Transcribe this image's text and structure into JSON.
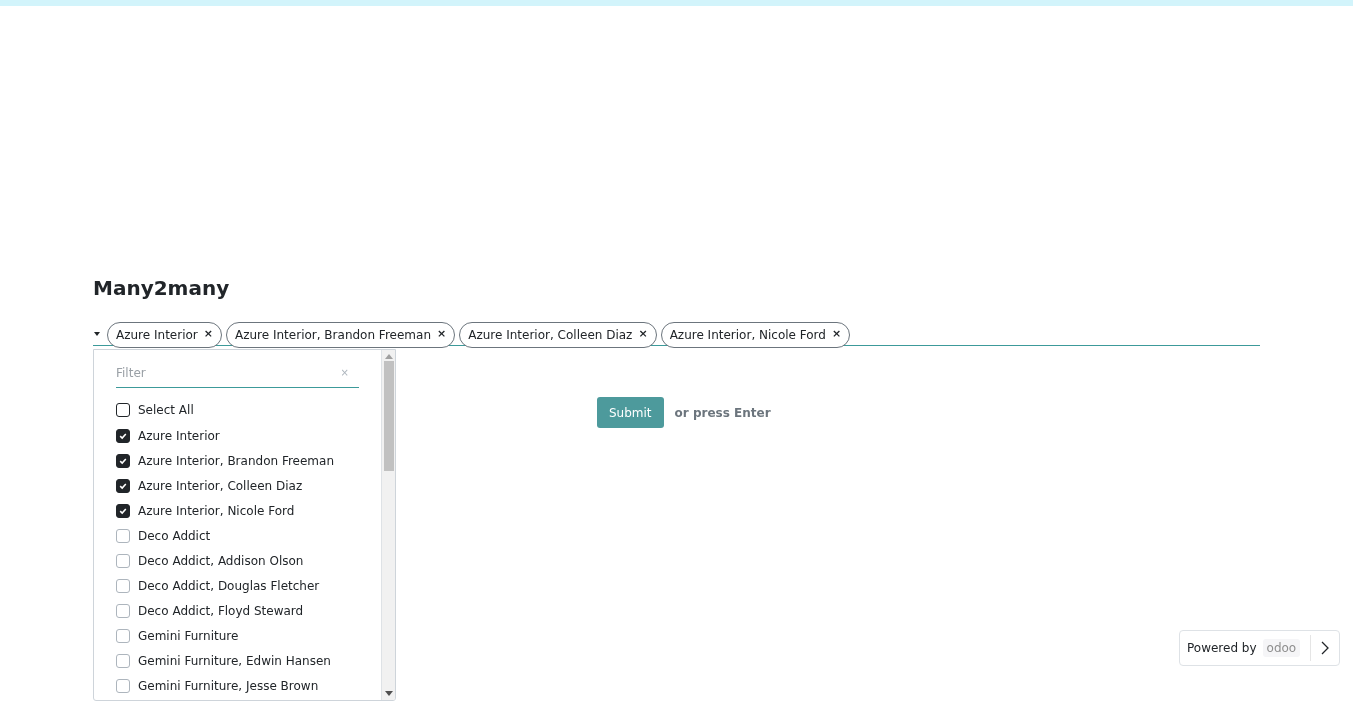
{
  "title": "Many2many",
  "tags": [
    {
      "label": "Azure Interior",
      "remove": "×"
    },
    {
      "label": "Azure Interior, Brandon Freeman",
      "remove": "×"
    },
    {
      "label": "Azure Interior, Colleen Diaz",
      "remove": "×"
    },
    {
      "label": "Azure Interior, Nicole Ford",
      "remove": "×"
    }
  ],
  "dropdown": {
    "filter": {
      "placeholder": "Filter",
      "clear": "×"
    },
    "select_all": {
      "label": "Select All",
      "checked": false
    },
    "options": [
      {
        "label": "Azure Interior",
        "checked": true
      },
      {
        "label": "Azure Interior, Brandon Freeman",
        "checked": true
      },
      {
        "label": "Azure Interior, Colleen Diaz",
        "checked": true
      },
      {
        "label": "Azure Interior, Nicole Ford",
        "checked": true
      },
      {
        "label": "Deco Addict",
        "checked": false
      },
      {
        "label": "Deco Addict, Addison Olson",
        "checked": false
      },
      {
        "label": "Deco Addict, Douglas Fletcher",
        "checked": false
      },
      {
        "label": "Deco Addict, Floyd Steward",
        "checked": false
      },
      {
        "label": "Gemini Furniture",
        "checked": false
      },
      {
        "label": "Gemini Furniture, Edwin Hansen",
        "checked": false
      },
      {
        "label": "Gemini Furniture, Jesse Brown",
        "checked": false
      }
    ]
  },
  "submit": {
    "label": "Submit",
    "hint": "or press Enter"
  },
  "powered_by": {
    "label": "Powered by",
    "logo": "odoo"
  }
}
